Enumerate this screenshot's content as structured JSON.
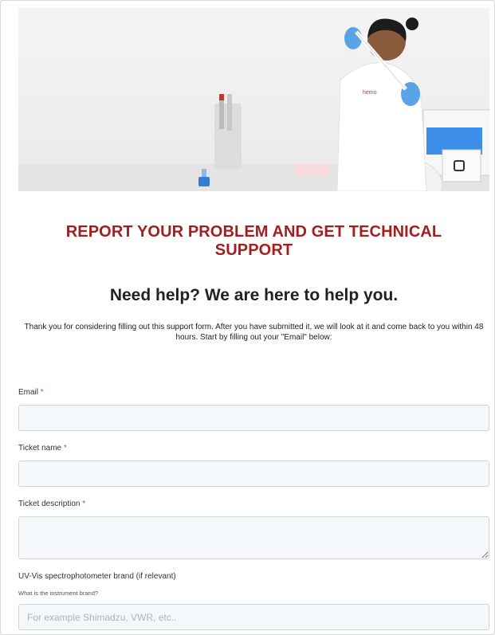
{
  "hero": {
    "logo_text": "hemo"
  },
  "header": {
    "title": "REPORT YOUR PROBLEM AND GET TECHNICAL SUPPORT",
    "subtitle": "Need help? We are here to help you.",
    "intro": "Thank you for considering filling out this support form. After you have submitted it, we will look at it and come back to you within 48 hours. Start by filling out your \"Email\" below:"
  },
  "form": {
    "required_marker": "*",
    "email": {
      "label": "Email",
      "value": "",
      "placeholder": ""
    },
    "ticket_name": {
      "label": "Ticket name",
      "value": "",
      "placeholder": ""
    },
    "ticket_description": {
      "label": "Ticket description",
      "value": "",
      "placeholder": ""
    },
    "uv_brand": {
      "label": "UV-Vis spectrophotometer brand (if relevant)",
      "help": "What is the instrument brand?",
      "value": "",
      "placeholder": "For example Shimadzu, VWR, etc.."
    }
  },
  "colors": {
    "title": "#a31f1f",
    "required": "#e5403f",
    "input_bg": "#f5f8fa",
    "input_border": "#cbd6e2"
  }
}
